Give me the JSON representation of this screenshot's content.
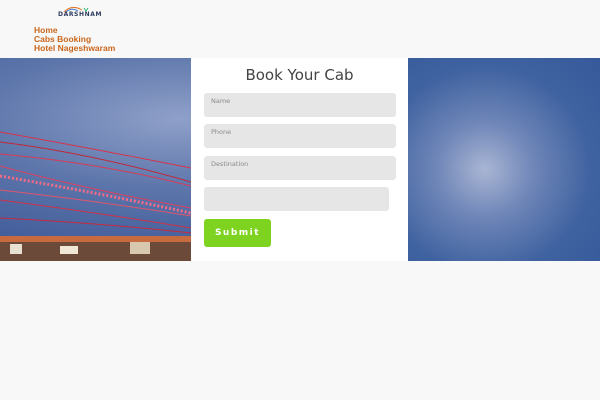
{
  "header": {
    "logo_text": "DARSHNAM",
    "nav": [
      {
        "label": "Home"
      },
      {
        "label": "Cabs Booking"
      },
      {
        "label": "Hotel Nageshwaram"
      }
    ]
  },
  "form": {
    "title": "Book Your Cab",
    "fields": {
      "name_placeholder": "Name",
      "phone_placeholder": "Phone",
      "destination_placeholder": "Destination",
      "extra_value": ""
    },
    "submit_label": "Submit"
  },
  "colors": {
    "nav_link": "#c9651a",
    "submit_bg": "#7ed321",
    "field_bg": "#e6e6e6"
  }
}
